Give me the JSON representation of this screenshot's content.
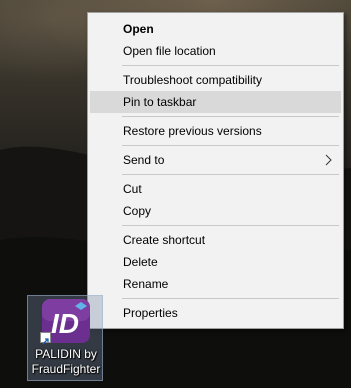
{
  "context_menu": {
    "items": [
      {
        "label": "Open"
      },
      {
        "label": "Open file location"
      },
      {
        "label": "Troubleshoot compatibility"
      },
      {
        "label": "Pin to taskbar"
      },
      {
        "label": "Restore previous versions"
      },
      {
        "label": "Send to"
      },
      {
        "label": "Cut"
      },
      {
        "label": "Copy"
      },
      {
        "label": "Create shortcut"
      },
      {
        "label": "Delete"
      },
      {
        "label": "Rename"
      },
      {
        "label": "Properties"
      }
    ]
  },
  "desktop": {
    "icon": {
      "label_line1": "PALIDIN by",
      "label_line2": "FraudFighter",
      "logo_text": "ID"
    }
  },
  "colors": {
    "menu_bg": "#f2f2f2",
    "hover_bg": "#d9d9d9",
    "icon_purple": "#6b2f8f"
  }
}
